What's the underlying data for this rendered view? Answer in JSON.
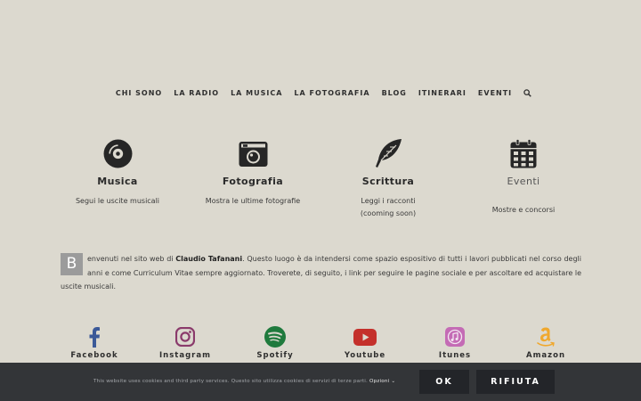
{
  "nav": {
    "items": [
      "CHI SONO",
      "LA RADIO",
      "LA MUSICA",
      "LA FOTOGRAFIA",
      "BLOG",
      "ITINERARI",
      "EVENTI"
    ],
    "search_icon": "search-icon"
  },
  "features": [
    {
      "icon": "vinyl-disc-icon",
      "title": "Musica",
      "desc": [
        "Segui le uscite musicali"
      ]
    },
    {
      "icon": "camera-icon",
      "title": "Fotografia",
      "desc": [
        "Mostra le ultime fotografie"
      ]
    },
    {
      "icon": "feather-icon",
      "title": "Scrittura",
      "desc": [
        "Leggi i racconti",
        "(cooming soon)"
      ]
    },
    {
      "icon": "calendar-icon",
      "title": "Eventi",
      "desc": [
        "Mostre e concorsi"
      ]
    }
  ],
  "intro": {
    "dropcap": "B",
    "before": "envenuti nel sito web di ",
    "name": "Claudio Tafanani",
    "after": ". Questo luogo è da intendersi come spazio espositivo di tutti i lavori pubblicati nel corso degli anni e come Curriculum Vitae sempre aggiornato. Troverete, di seguito, i link per seguire le pagine sociale e per ascoltare ed acquistare le uscite musicali."
  },
  "social": [
    {
      "icon": "facebook-icon",
      "label": "Facebook",
      "color": "#3b5998"
    },
    {
      "icon": "instagram-icon",
      "label": "Instagram",
      "color": "#8a3a6b"
    },
    {
      "icon": "spotify-icon",
      "label": "Spotify",
      "color": "#1f7a3d"
    },
    {
      "icon": "youtube-icon",
      "label": "Youtube",
      "color": "#c4302b"
    },
    {
      "icon": "itunes-icon",
      "label": "Itunes",
      "color": "#c46bb5"
    },
    {
      "icon": "amazon-icon",
      "label": "Amazon",
      "color": "#f0a82d"
    }
  ],
  "cookie": {
    "text": "This website uses cookies and third party services. Questo sito utilizza cookies di servizi di terze parti.",
    "options": "Opzioni",
    "ok": "OK",
    "refuse": "RIFIUTA"
  }
}
